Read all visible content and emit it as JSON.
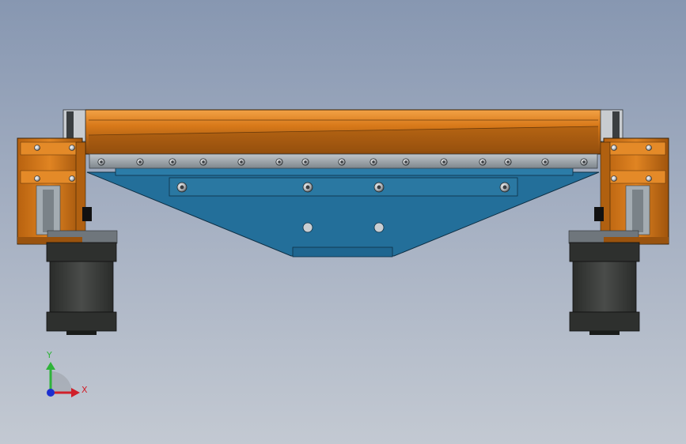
{
  "viewport": {
    "background_top": "#8797b1",
    "background_bottom": "#c3c9d2"
  },
  "model": {
    "colors": {
      "orange": "#d97a1a",
      "orange_dark": "#8a4a0c",
      "orange_light": "#f0a040",
      "blue_plate": "#236f9a",
      "blue_dark": "#174f70",
      "rail": "#9aa2a8",
      "motor": "#3c3e3c",
      "motor_dark": "#262826"
    },
    "icons": [
      "socket-screw-icon",
      "bolt-hole-icon"
    ]
  },
  "triad": {
    "y_label": "Y",
    "x_label": "X",
    "y_color": "#2fb33a",
    "x_color": "#d0202a",
    "z_color": "#1c2fd0"
  }
}
